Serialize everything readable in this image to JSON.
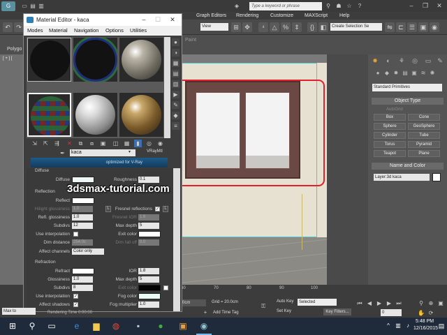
{
  "app": {
    "search_placeholder": "Type a keyword or phrase",
    "menu": [
      "Graph Editors",
      "Rendering",
      "Customize",
      "MAXScript",
      "Help"
    ],
    "view_dropdown": "View",
    "selection_set_dropdown": "Create Selection Se",
    "ribbon": {
      "paint_label": "Paint",
      "polygon_label": "Polygo"
    },
    "viewport_label": "[ + ] [ "
  },
  "material_editor": {
    "title": "Material Editor - kaca",
    "menu": [
      "Modes",
      "Material",
      "Navigation",
      "Options",
      "Utilities"
    ],
    "material_name": "kaca",
    "material_type": "VRayMtl",
    "banner_text": "optimized for V-Ray",
    "diffuse": {
      "section": "Diffuse",
      "diffuse_label": "Diffuse",
      "roughness_label": "Roughness",
      "roughness_value": "0.1"
    },
    "reflection": {
      "section": "Reflection",
      "reflect_label": "Reflect",
      "hilight_gloss_label": "Hilight glossiness",
      "hilight_gloss_value": "1.0",
      "hilight_lock": "L",
      "fresnel_label": "Fresnel reflections",
      "fresnel_check": "✓",
      "fresnel_lock": "L",
      "refl_gloss_label": "Refl. glossiness",
      "refl_gloss_value": "1.0",
      "fresnel_ior_label": "Fresnel IOR",
      "fresnel_ior_value": "1.6",
      "subdivs_label": "Subdivs",
      "subdivs_value": "12",
      "max_depth_label": "Max depth",
      "max_depth_value": "5",
      "use_interp_label": "Use interpolation",
      "exit_color_label": "Exit color",
      "dim_distance_label": "Dim distance",
      "dim_distance_value": "254.0c",
      "dim_falloff_label": "Dim fall off",
      "dim_falloff_value": "0.0",
      "affect_channels_label": "Affect channels",
      "affect_channels_value": "Color only"
    },
    "refraction": {
      "section": "Refraction",
      "refract_label": "Refract",
      "ior_label": "IOR",
      "ior_value": "1.8",
      "glossiness_label": "Glossiness",
      "glossiness_value": "1.0",
      "max_depth_label": "Max depth",
      "max_depth_value": "5",
      "subdivs_label": "Subdivs",
      "subdivs_value": "8",
      "exit_color_label": "Exit color",
      "use_interp_label": "Use interpolation",
      "use_interp_check": "✓",
      "fog_color_label": "Fog color",
      "affect_shadows_label": "Affect shadows",
      "affect_shadows_check": "✓",
      "fog_multiplier_label": "Fog multiplier",
      "fog_multiplier_value": "1.0"
    }
  },
  "watermark": "3dsmax-tutorial.com",
  "command_panel": {
    "primitives_dropdown": "Standard Primitives",
    "object_type_header": "Object Type",
    "autogrid_label": "AutoGrid",
    "buttons": [
      "Box",
      "Cone",
      "Sphere",
      "GeoSphere",
      "Cylinder",
      "Tube",
      "Torus",
      "Pyramid",
      "Teapot",
      "Plane"
    ],
    "name_color_header": "Name and Color",
    "layer_name": "Layer:3d kaca"
  },
  "timeline": {
    "ticks": [
      "60",
      "70",
      "80",
      "90",
      "100"
    ],
    "coord_value": "0cm",
    "grid_label": "Grid = 20.0cm",
    "add_time_tag": "Add Time Tag",
    "auto_key": "Auto Key",
    "selected_dropdown": "Selected",
    "set_key": "Set Key",
    "key_filters": "Key Filters...",
    "frame_value": "0",
    "rendering_time": "Rendering Time  0:00:00",
    "maxscript_text": "Max to"
  },
  "taskbar": {
    "time": "5:48 PM",
    "date": "12/16/2015"
  },
  "colors": {
    "highlight": "#e41e2a",
    "window_frame": "#6a4844",
    "accent": "#e8a03b"
  }
}
